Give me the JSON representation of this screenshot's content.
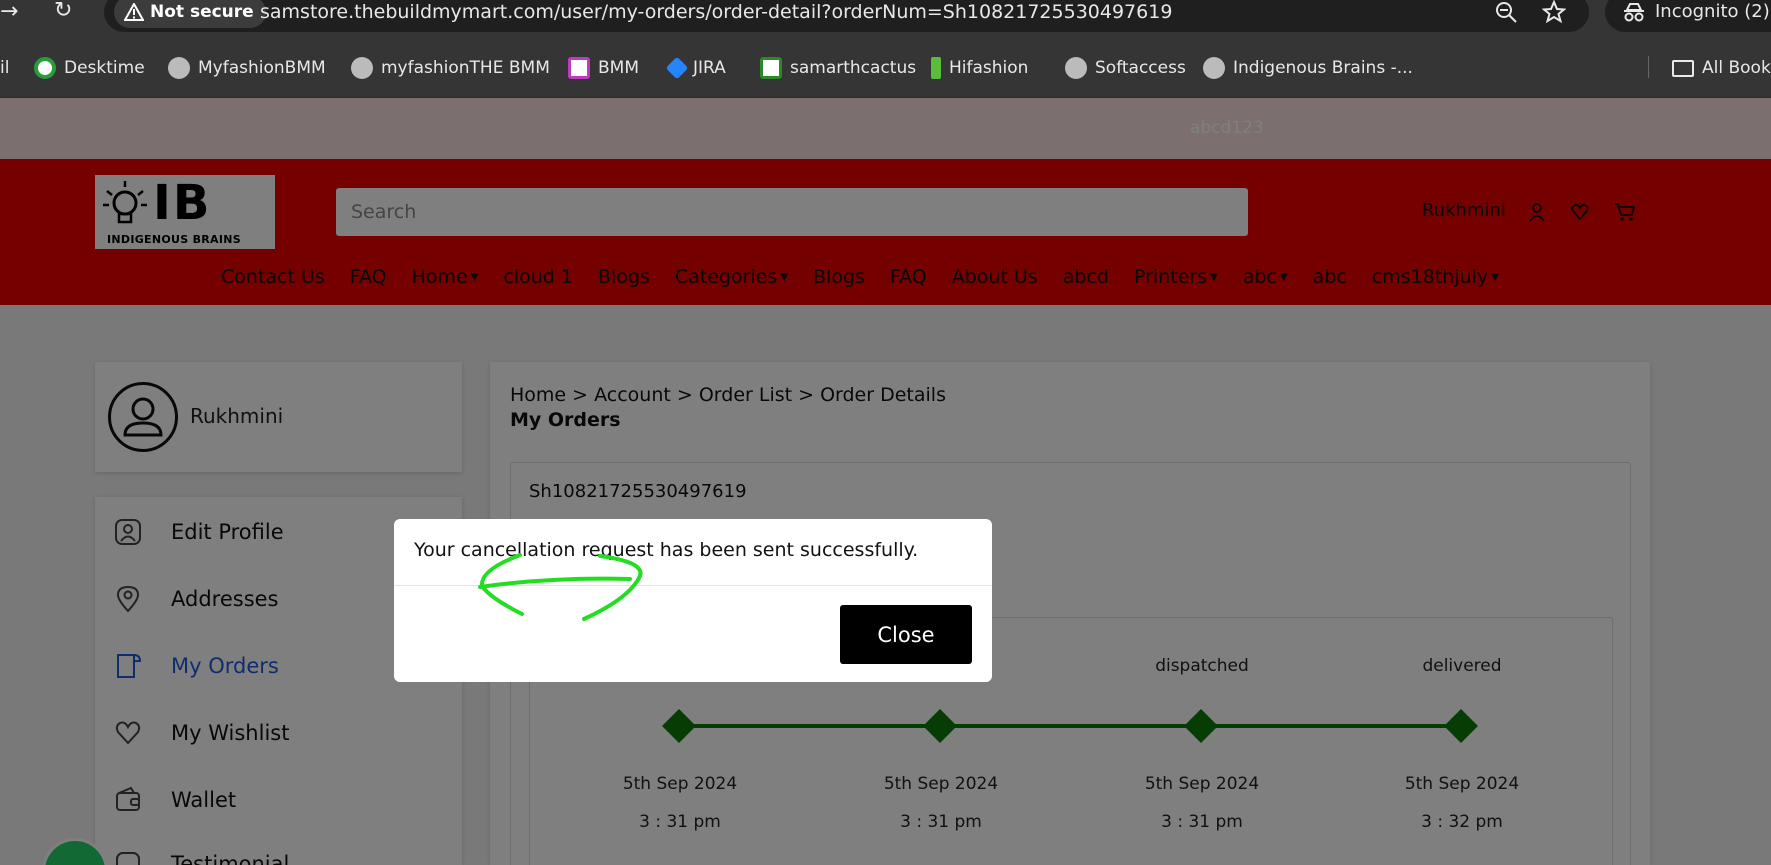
{
  "browser": {
    "not_secure": "Not secure",
    "url": "samstore.thebuildmymart.com/user/my-orders/order-detail?orderNum=Sh10821725530497619",
    "incognito": "Incognito (2)",
    "bookmarks": [
      {
        "label": "Desktime"
      },
      {
        "label": "MyfashionBMM"
      },
      {
        "label": "myfashionTHE BMM"
      },
      {
        "label": "BMM"
      },
      {
        "label": "JIRA"
      },
      {
        "label": "samarthcactus"
      },
      {
        "label": "Hifashion"
      },
      {
        "label": "Softaccess"
      },
      {
        "label": "Indigenous Brains -..."
      }
    ],
    "bookmark_partial": "il",
    "all_bookmarks": "All Book"
  },
  "announcement": "abcd123",
  "header": {
    "logo_text": "IB",
    "logo_sub": "INDIGENOUS BRAINS",
    "search_placeholder": "Search",
    "user_name": "Rukhmini",
    "menu": [
      {
        "label": "Contact Us",
        "dropdown": false
      },
      {
        "label": "FAQ",
        "dropdown": false
      },
      {
        "label": "Home",
        "dropdown": true
      },
      {
        "label": "cloud 1",
        "dropdown": false
      },
      {
        "label": "Blogs",
        "dropdown": false
      },
      {
        "label": "Categories",
        "dropdown": true
      },
      {
        "label": "Blogs",
        "dropdown": false
      },
      {
        "label": "FAQ",
        "dropdown": false
      },
      {
        "label": "About Us",
        "dropdown": false
      },
      {
        "label": "abcd",
        "dropdown": false
      },
      {
        "label": "Printers",
        "dropdown": true
      },
      {
        "label": "abc",
        "dropdown": true
      },
      {
        "label": "abc",
        "dropdown": false
      },
      {
        "label": "cms18thjuly",
        "dropdown": true
      }
    ]
  },
  "profile": {
    "name": "Rukhmini"
  },
  "sidebar": [
    {
      "label": "Edit Profile",
      "icon": "user-square-icon"
    },
    {
      "label": "Addresses",
      "icon": "location-pin-icon"
    },
    {
      "label": "My Orders",
      "icon": "orders-icon",
      "active": true
    },
    {
      "label": "My Wishlist",
      "icon": "heart-icon"
    },
    {
      "label": "Wallet",
      "icon": "wallet-icon"
    },
    {
      "label": "Testimonial",
      "icon": "testimonial-icon"
    }
  ],
  "main": {
    "breadcrumb": "Home > Account > Order List > Order Details",
    "title": "My Orders",
    "order_number": "Sh10821725530497619",
    "tracking": [
      {
        "label": "",
        "date": "5th Sep 2024",
        "time": "3 : 31 pm"
      },
      {
        "label": "",
        "date": "5th Sep 2024",
        "time": "3 : 31 pm"
      },
      {
        "label": "dispatched",
        "date": "5th Sep 2024",
        "time": "3 : 31 pm"
      },
      {
        "label": "delivered",
        "date": "5th Sep 2024",
        "time": "3 : 32 pm"
      }
    ]
  },
  "modal": {
    "message": "Your cancellation request has been sent successfully.",
    "close_label": "Close"
  },
  "colors": {
    "header_red": "#e80000",
    "track_green": "#0a7a0a",
    "active_blue": "#1f5bd6",
    "annotation_green": "#22dd22"
  }
}
